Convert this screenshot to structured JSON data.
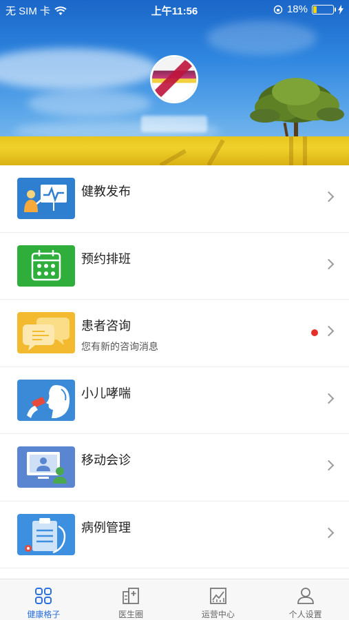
{
  "status_bar": {
    "carrier": "无 SIM 卡",
    "time": "上午11:56",
    "battery": "18%",
    "battery_level": 0.18,
    "icons": [
      "wifi-icon",
      "orientation-lock-icon",
      "battery-icon",
      "charging-icon"
    ]
  },
  "profile": {
    "avatar_icon": "user-avatar",
    "nickname_blurred": true
  },
  "menu": {
    "items": [
      {
        "label": "健教发布",
        "subtitle": "",
        "icon": "health-education-icon",
        "color": "#2f7fd1"
      },
      {
        "label": "预约排班",
        "subtitle": "",
        "icon": "calendar-icon",
        "color": "#2fae3c"
      },
      {
        "label": "患者咨询",
        "subtitle": "您有新的咨询消息",
        "icon": "chat-bubbles-icon",
        "color": "#f3b92f",
        "unread": true
      },
      {
        "label": "小儿哮喘",
        "subtitle": "",
        "icon": "asthma-inhaler-icon",
        "color": "#3b8ad8"
      },
      {
        "label": "移动会诊",
        "subtitle": "",
        "icon": "video-consultation-icon",
        "color": "#5a86d1"
      },
      {
        "label": "病例管理",
        "subtitle": "",
        "icon": "medical-record-icon",
        "color": "#3d8fe0"
      }
    ]
  },
  "tabbar": {
    "tabs": [
      {
        "label": "健康格子",
        "icon": "grid-icon",
        "active": true
      },
      {
        "label": "医生圈",
        "icon": "hospital-icon",
        "active": false
      },
      {
        "label": "运营中心",
        "icon": "chart-icon",
        "active": false
      },
      {
        "label": "个人设置",
        "icon": "person-icon",
        "active": false
      }
    ]
  },
  "colors": {
    "accent": "#2a6fe0",
    "unread_dot": "#e5302a"
  }
}
